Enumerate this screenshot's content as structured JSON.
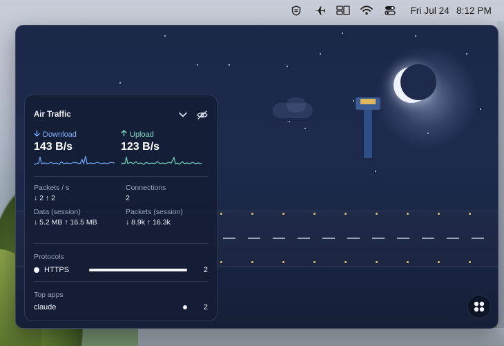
{
  "menubar": {
    "icons": [
      "shield-icon",
      "airplane-icon",
      "display-icon",
      "wifi-icon",
      "control-center-icon"
    ],
    "date": "Fri Jul 24",
    "time": "8:12 PM"
  },
  "panel": {
    "title": "Air Traffic",
    "download": {
      "label": "Download",
      "value": "143 B/s",
      "color": "#7fb2ff"
    },
    "upload": {
      "label": "Upload",
      "value": "123 B/s",
      "color": "#7ddcc4"
    },
    "stats": {
      "packets_label": "Packets / s",
      "packets_value": "↓ 2 ↑ 2",
      "connections_label": "Connections",
      "connections_value": "2",
      "data_label": "Data (session)",
      "data_value": "↓ 5.2 MB ↑ 16.5 MB",
      "packets_session_label": "Packets (session)",
      "packets_session_value": "↓ 8.9k ↑ 16.3k"
    },
    "protocols_label": "Protocols",
    "protocols": [
      {
        "name": "HTTPS",
        "count": "2",
        "share": 1.0
      }
    ],
    "top_apps_label": "Top apps",
    "apps": [
      {
        "name": "claude",
        "count": "2"
      }
    ]
  }
}
